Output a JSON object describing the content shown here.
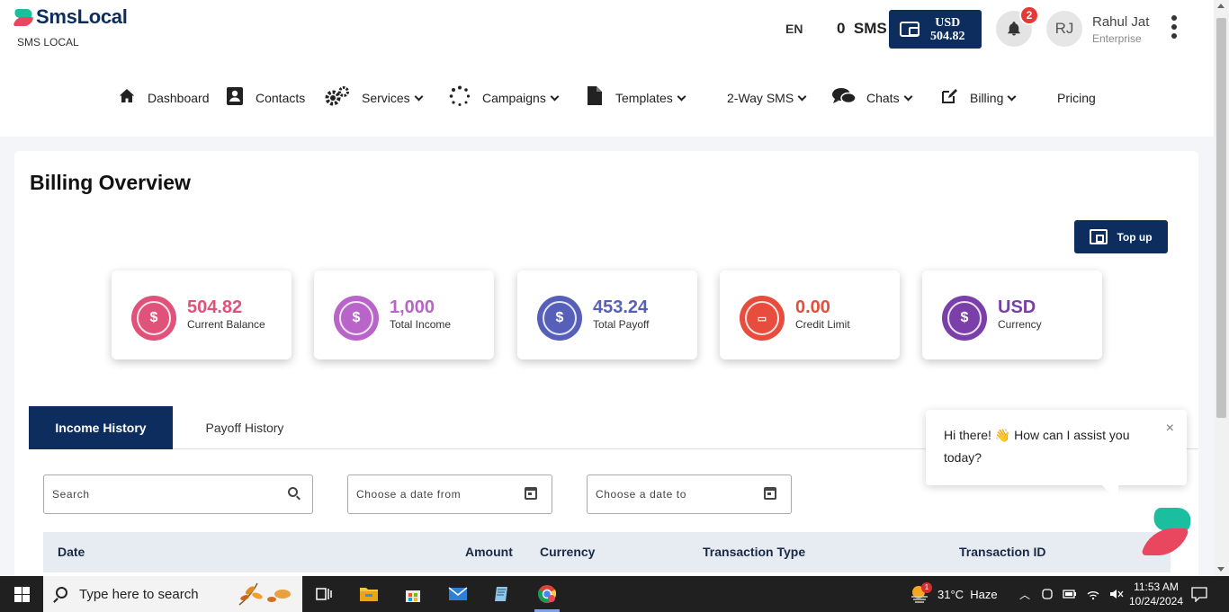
{
  "brand": {
    "name": "SmsLocal",
    "sub": "SMS LOCAL"
  },
  "header": {
    "lang": "EN",
    "sms": "0  SMS",
    "wallet": {
      "currency": "USD",
      "amount": "504.82"
    },
    "notifications": "2",
    "user": {
      "initials": "RJ",
      "name": "Rahul Jat",
      "role": "Enterprise"
    }
  },
  "nav": [
    {
      "label": "Dashboard",
      "icon": "home-icon"
    },
    {
      "label": "Contacts",
      "icon": "contact-card-icon"
    },
    {
      "label": "Services",
      "icon": "gears-icon"
    },
    {
      "label": "Campaigns",
      "icon": "spinner-icon"
    },
    {
      "label": "Templates",
      "icon": "file-icon"
    },
    {
      "label": "2-Way SMS"
    },
    {
      "label": "Chats",
      "icon": "chat-bubbles-icon"
    },
    {
      "label": "Billing",
      "icon": "edit-icon"
    },
    {
      "label": "Pricing"
    }
  ],
  "page": {
    "title": "Billing Overview",
    "topup": "Top up"
  },
  "stats": [
    {
      "value": "504.82",
      "label": "Current Balance",
      "color": "#e0527a",
      "icon": "money-hand-icon"
    },
    {
      "value": "1,000",
      "label": "Total Income",
      "color": "#b864c8",
      "icon": "coins-icon"
    },
    {
      "value": "453.24",
      "label": "Total Payoff",
      "color": "#5660b8",
      "icon": "payout-icon"
    },
    {
      "value": "0.00",
      "label": "Credit Limit",
      "color": "#e74c3c",
      "icon": "credit-card-icon"
    },
    {
      "value": "USD",
      "label": "Currency",
      "color": "#7a3fa8",
      "icon": "currency-icon"
    }
  ],
  "tabs": {
    "active": "Income History",
    "other": "Payoff History"
  },
  "filters": {
    "search": "Search",
    "date_from": "Choose a date from",
    "date_to": "Choose a date to"
  },
  "table": {
    "headers": [
      "Date",
      "Amount",
      "Currency",
      "Transaction Type",
      "Transaction ID"
    ]
  },
  "chat": {
    "message": "Hi there! 👋 How can I assist you today?",
    "close": "×"
  },
  "taskbar": {
    "search": "Type here to search",
    "weather": "31°C  Haze",
    "time": "11:53 AM",
    "date": "10/24/2024",
    "weather_badge": "1"
  }
}
